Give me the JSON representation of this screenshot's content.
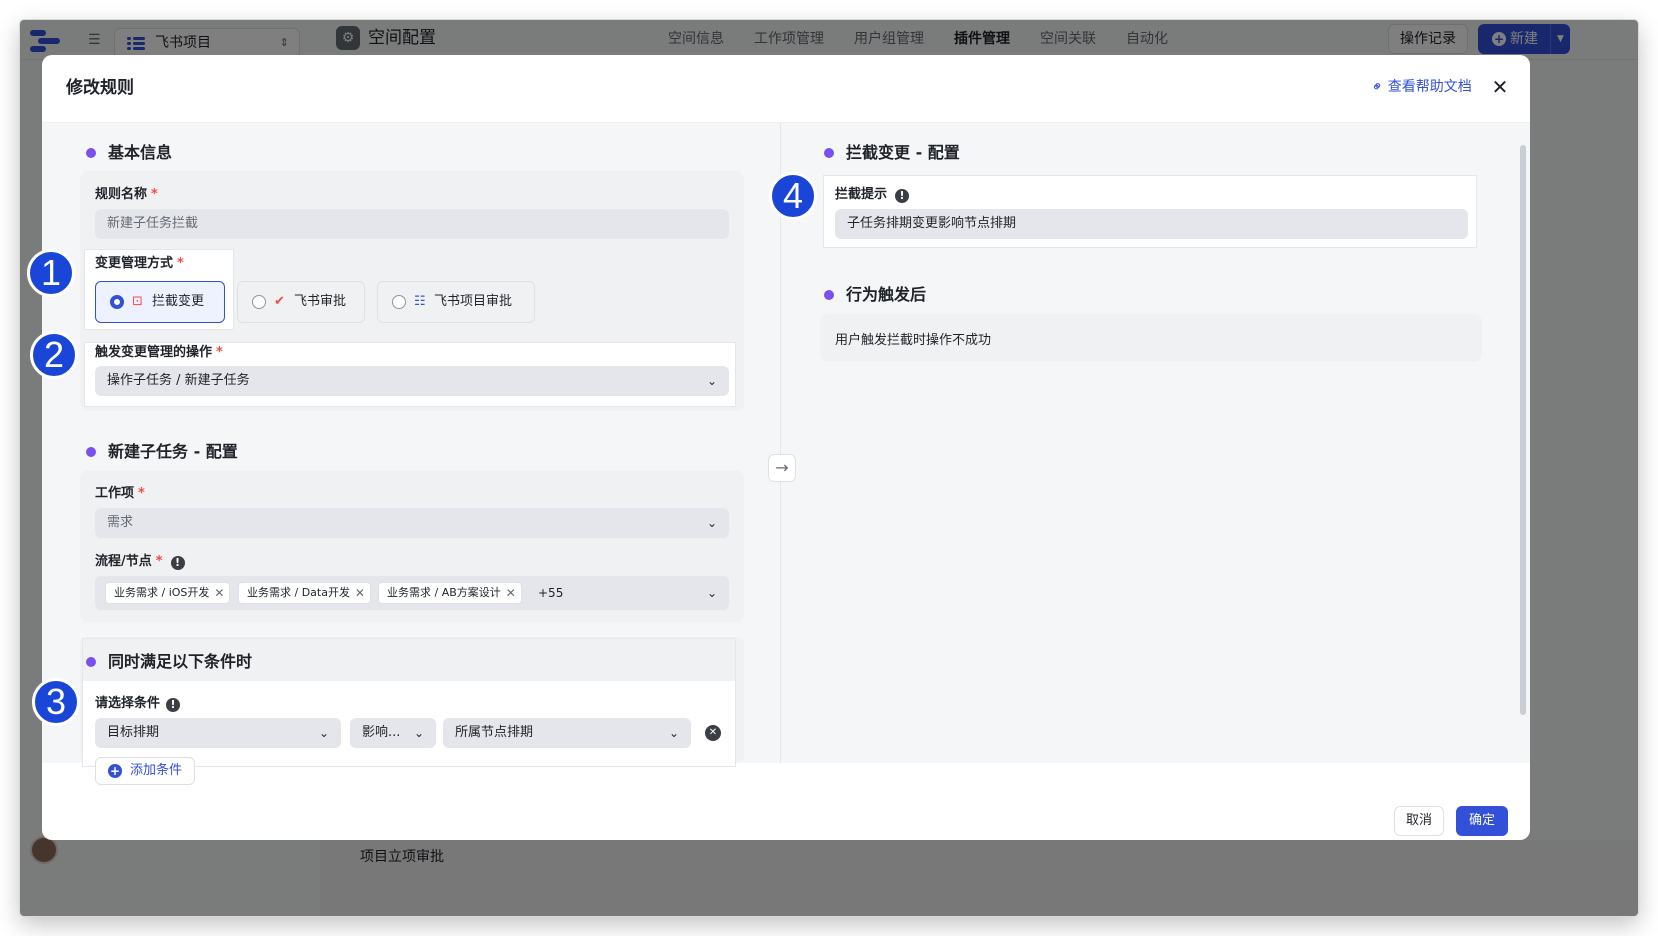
{
  "app": {
    "project_selector": "飞书项目",
    "space_title": "空间配置",
    "nav": [
      "空间信息",
      "工作项管理",
      "用户组管理",
      "插件管理",
      "空间关联",
      "自动化"
    ],
    "nav_active_index": 3,
    "op_log_button": "操作记录",
    "new_button": "新建",
    "bottom_row_text": "项目立项审批"
  },
  "modal": {
    "title": "修改规则",
    "help_link": "查看帮助文档",
    "basic_section_title": "基本信息",
    "rule_name_label": "规则名称",
    "rule_name_value": "新建子任务拦截",
    "change_mgmt_label": "变更管理方式",
    "change_mgmt_options": [
      "拦截变更",
      "飞书审批",
      "飞书项目审批"
    ],
    "change_mgmt_selected_index": 0,
    "trigger_label": "触发变更管理的操作",
    "trigger_value": "操作子任务 / 新建子任务",
    "subtask_section_title": "新建子任务 - 配置",
    "work_item_label": "工作项",
    "work_item_value": "需求",
    "flow_node_label": "流程/节点",
    "flow_node_tags": [
      "业务需求 / iOS开发",
      "业务需求 / Data开发",
      "业务需求 / AB方案设计"
    ],
    "flow_node_more": "+55",
    "condition_section_title": "同时满足以下条件时",
    "condition_label": "请选择条件",
    "condition_field": "目标排期",
    "condition_operator": "影响...",
    "condition_value": "所属节点排期",
    "add_condition_button": "添加条件",
    "intercept_section_title": "拦截变更 - 配置",
    "intercept_tip_label": "拦截提示",
    "intercept_tip_value": "子任务排期变更影响节点排期",
    "after_trigger_section_title": "行为触发后",
    "after_trigger_text": "用户触发拦截时操作不成功",
    "cancel_button": "取消",
    "confirm_button": "确定"
  },
  "annotations": [
    "1",
    "2",
    "3",
    "4"
  ],
  "colors": {
    "accent": "#3250d8",
    "section_dot": "#7b4ff0",
    "required": "#f54a45",
    "badge": "#1a46d8"
  }
}
